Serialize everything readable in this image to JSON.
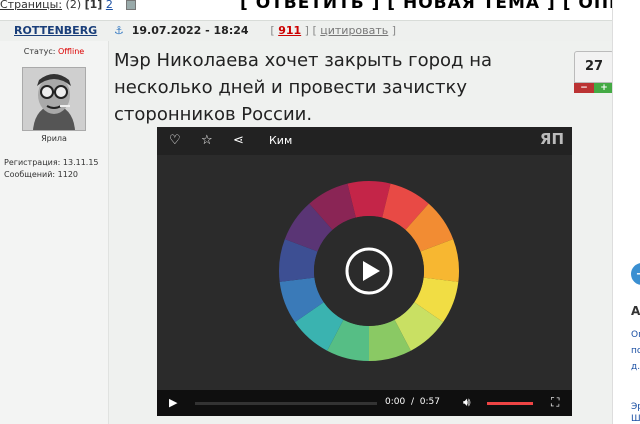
{
  "topbar": {
    "pages_label": "Страницы:",
    "pages_count": "(2)",
    "current_page": "[1]",
    "next_page": "2",
    "actions": [
      "[ ОТВЕТИТЬ ]",
      "[ НОВАЯ ТЕМА ]",
      "[ ОПРОС ]"
    ]
  },
  "post": {
    "author": "ROTTENBERG",
    "datetime": "19.07.2022 - 18:24",
    "counter_open": "[",
    "counter": "911",
    "counter_close": "]",
    "quote_open": "[",
    "quote_label": "цитировать",
    "quote_close": "]",
    "text": "Мэр Николаева хочет закрыть город на несколько дней и провести зачистку сторонников России.",
    "rating": "27",
    "rating_minus": "−",
    "rating_plus": "+"
  },
  "user": {
    "status_label": "Статус:",
    "status_value": "Offline",
    "avatar_caption": "Ярила",
    "registration": "Регистрация: 13.11.15",
    "messages": "Сообщений: 1120"
  },
  "video": {
    "title": "Ким",
    "logo": "ЯП",
    "time_current": "0:00",
    "time_separator": "/",
    "time_total": "0:57",
    "icons": [
      "heart-icon",
      "star-icon",
      "share-icon",
      "play-icon",
      "volume-icon",
      "fullscreen-icon"
    ],
    "wheel_colors": [
      "#c42548",
      "#e84a45",
      "#f28c33",
      "#f7b731",
      "#f1dd44",
      "#c9e063",
      "#8ac964",
      "#56be85",
      "#3ab3b0",
      "#3a7ab8",
      "#3d4f93",
      "#5a3575",
      "#8a2555"
    ]
  },
  "right_sidebar": {
    "heading": "А",
    "lines": [
      "Ог",
      "пс",
      "д.",
      "Эр",
      "Ш"
    ]
  }
}
